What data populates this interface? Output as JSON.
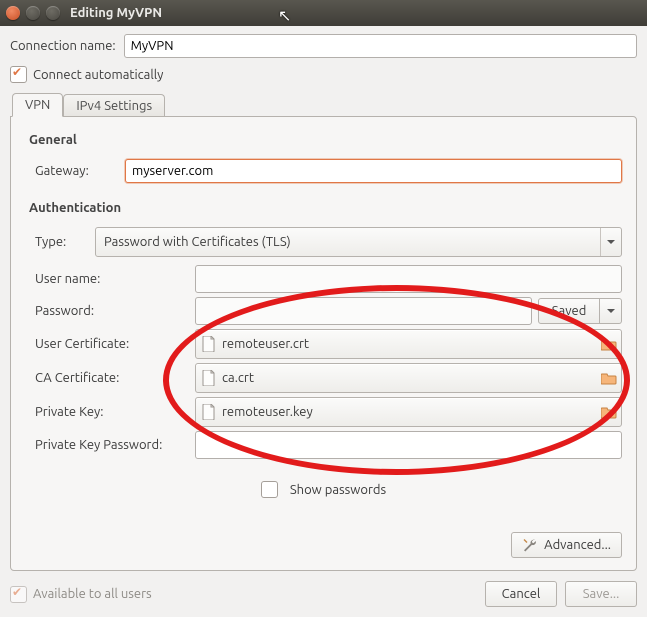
{
  "window": {
    "title": "Editing MyVPN"
  },
  "connection": {
    "name_label": "Connection name:",
    "name_value": "MyVPN",
    "auto_connect_label": "Connect automatically",
    "auto_connect_checked": true
  },
  "tabs": {
    "vpn": "VPN",
    "ipv4": "IPv4 Settings",
    "active": "vpn"
  },
  "general": {
    "heading": "General",
    "gateway_label": "Gateway:",
    "gateway_value": "myserver.com"
  },
  "auth": {
    "heading": "Authentication",
    "type_label": "Type:",
    "type_value": "Password with Certificates (TLS)",
    "username_label": "User name:",
    "username_value": "",
    "password_label": "Password:",
    "password_value": "",
    "password_mode_label": "Saved",
    "user_cert_label": "User Certificate:",
    "user_cert_value": "remoteuser.crt",
    "ca_cert_label": "CA Certificate:",
    "ca_cert_value": "ca.crt",
    "private_key_label": "Private Key:",
    "private_key_value": "remoteuser.key",
    "pk_password_label": "Private Key Password:",
    "pk_password_value": "",
    "show_passwords_label": "Show passwords",
    "show_passwords_checked": false,
    "advanced_label": "Advanced..."
  },
  "footer": {
    "available_label": "Available to all users",
    "available_checked": true,
    "cancel": "Cancel",
    "save": "Save..."
  }
}
